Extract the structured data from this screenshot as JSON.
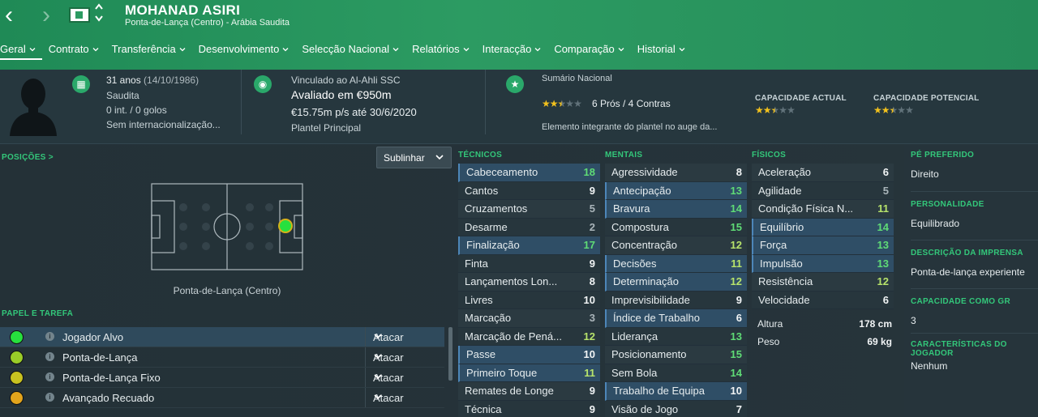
{
  "header": {
    "back_icon": "‹",
    "forward_icon": "›",
    "updown_icon": "︿﹀",
    "player_name": "MOHANAD ASIRI",
    "player_subtitle": "Ponta-de-Lança (Centro) - Arábia Saudita"
  },
  "tabs": [
    {
      "label": "Geral"
    },
    {
      "label": "Contrato"
    },
    {
      "label": "Transferência"
    },
    {
      "label": "Desenvolvimento"
    },
    {
      "label": "Selecção Nacional"
    },
    {
      "label": "Relatórios"
    },
    {
      "label": "Interacção"
    },
    {
      "label": "Comparação"
    },
    {
      "label": "Historial"
    }
  ],
  "info": {
    "age": "31 anos",
    "dob": "(14/10/1986)",
    "nationality": "Saudita",
    "intl": "0 int. / 0 golos",
    "intl_status": "Sem internacionalização...",
    "contract_club": "Vinculado ao Al-Ahli SSC",
    "value": "Avaliado em €950m",
    "wage": "€15.75m p/s até 30/6/2020",
    "squad": "Plantel Principal",
    "national_summary_label": "Sumário Nacional",
    "pros_cons": "6 Prós / 4 Contras",
    "national_summary_text": "Elemento integrante do plantel no auge da...",
    "current_ability_label": "CAPACIDADE ACTUAL",
    "potential_ability_label": "CAPACIDADE POTENCIAL",
    "summary_stars": 2.5,
    "current_stars": 2.5,
    "potential_stars": 2.5,
    "star_total": 5
  },
  "positions": {
    "label": "POSIÇÕES >",
    "dropdown": "Sublinhar",
    "position_name": "Ponta-de-Lança (Centro)"
  },
  "roles": {
    "label": "PAPEL E TAREFA",
    "items": [
      {
        "name": "Jogador Alvo",
        "duty": "Atacar",
        "color": "#27e03e"
      },
      {
        "name": "Ponta-de-Lança",
        "duty": "Atacar",
        "color": "#9acd28"
      },
      {
        "name": "Ponta-de-Lança Fixo",
        "duty": "Atacar",
        "color": "#c8c220"
      },
      {
        "name": "Avançado Recuado",
        "duty": "Atacar",
        "color": "#e2a41c"
      }
    ]
  },
  "technical": {
    "label": "TÉCNICOS",
    "items": [
      {
        "name": "Cabeceamento",
        "value": "18",
        "hl": true
      },
      {
        "name": "Cantos",
        "value": "9"
      },
      {
        "name": "Cruzamentos",
        "value": "5"
      },
      {
        "name": "Desarme",
        "value": "2"
      },
      {
        "name": "Finalização",
        "value": "17",
        "hl": true
      },
      {
        "name": "Finta",
        "value": "9"
      },
      {
        "name": "Lançamentos Lon...",
        "value": "8"
      },
      {
        "name": "Livres",
        "value": "10"
      },
      {
        "name": "Marcação",
        "value": "3"
      },
      {
        "name": "Marcação de Pená...",
        "value": "12"
      },
      {
        "name": "Passe",
        "value": "10",
        "hl": true
      },
      {
        "name": "Primeiro Toque",
        "value": "11",
        "hl": true
      },
      {
        "name": "Remates de Longe",
        "value": "9"
      },
      {
        "name": "Técnica",
        "value": "9"
      }
    ]
  },
  "mental": {
    "label": "MENTAIS",
    "items": [
      {
        "name": "Agressividade",
        "value": "8"
      },
      {
        "name": "Antecipação",
        "value": "13",
        "hl": true
      },
      {
        "name": "Bravura",
        "value": "14",
        "hl": true
      },
      {
        "name": "Compostura",
        "value": "15"
      },
      {
        "name": "Concentração",
        "value": "12"
      },
      {
        "name": "Decisões",
        "value": "11",
        "hl": true
      },
      {
        "name": "Determinação",
        "value": "12",
        "hl": true
      },
      {
        "name": "Imprevisibilidade",
        "value": "9"
      },
      {
        "name": "Índice de Trabalho",
        "value": "6",
        "hl": true
      },
      {
        "name": "Liderança",
        "value": "13"
      },
      {
        "name": "Posicionamento",
        "value": "15"
      },
      {
        "name": "Sem Bola",
        "value": "14"
      },
      {
        "name": "Trabalho de Equipa",
        "value": "10",
        "hl": true
      },
      {
        "name": "Visão de Jogo",
        "value": "7"
      }
    ]
  },
  "physical": {
    "label": "FÍSICOS",
    "items": [
      {
        "name": "Aceleração",
        "value": "6"
      },
      {
        "name": "Agilidade",
        "value": "5"
      },
      {
        "name": "Condição Física N...",
        "value": "11"
      },
      {
        "name": "Equilíbrio",
        "value": "14",
        "hl": true
      },
      {
        "name": "Força",
        "value": "13",
        "hl": true
      },
      {
        "name": "Impulsão",
        "value": "13",
        "hl": true
      },
      {
        "name": "Resistência",
        "value": "12"
      },
      {
        "name": "Velocidade",
        "value": "6"
      }
    ],
    "height_label": "Altura",
    "height_value": "178 cm",
    "weight_label": "Peso",
    "weight_value": "69 kg"
  },
  "right": {
    "foot_label": "PÉ PREFERIDO",
    "foot_value": "Direito",
    "personality_label": "PERSONALIDADE",
    "personality_value": "Equilibrado",
    "press_label": "DESCRIÇÃO DA IMPRENSA",
    "press_value": "Ponta-de-lança experiente",
    "gk_label": "CAPACIDADE COMO GR",
    "gk_value": "3",
    "traits_label": "CARACTERÍSTICAS DO JOGADOR",
    "traits_value": "Nenhum"
  }
}
